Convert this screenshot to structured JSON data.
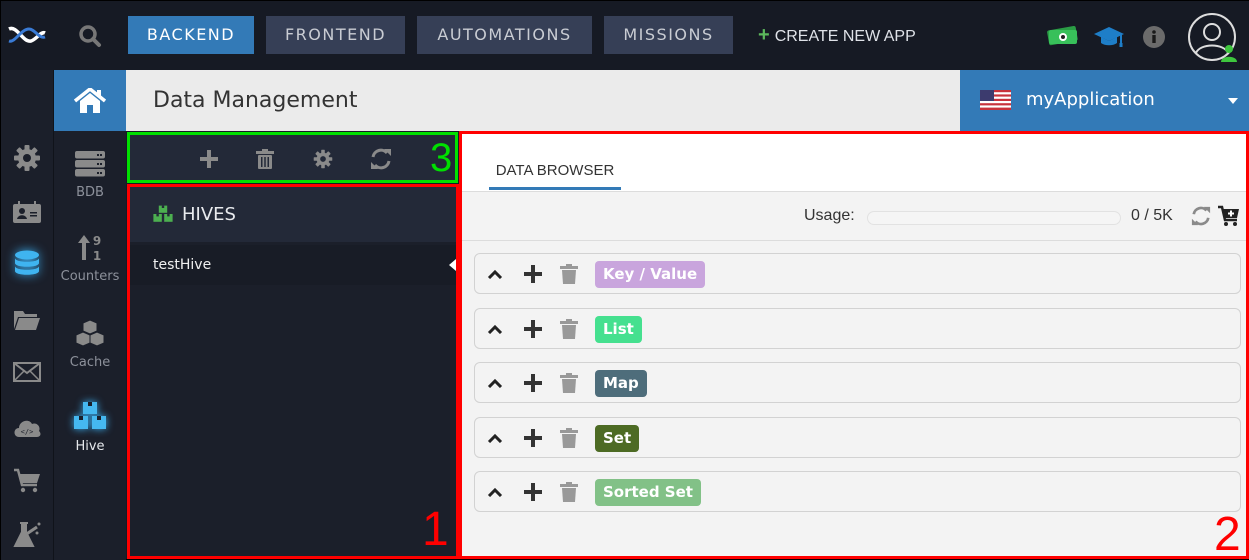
{
  "topbar": {
    "tabs": [
      {
        "label": "BACKEND",
        "active": true
      },
      {
        "label": "FRONTEND",
        "active": false
      },
      {
        "label": "AUTOMATIONS",
        "active": false
      },
      {
        "label": "MISSIONS",
        "active": false
      }
    ],
    "create_app_label": "CREATE NEW APP",
    "icons": [
      "logo-icon",
      "search-icon",
      "money-icon",
      "graduation-cap-icon",
      "info-icon",
      "user-avatar-icon"
    ]
  },
  "rail": {
    "items": [
      {
        "name": "settings",
        "icon": "gear-icon",
        "active": false
      },
      {
        "name": "users",
        "icon": "id-card-icon",
        "active": false
      },
      {
        "name": "data",
        "icon": "database-icon",
        "active": true
      },
      {
        "name": "files",
        "icon": "folder-icon",
        "active": false
      },
      {
        "name": "messaging",
        "icon": "envelope-icon",
        "active": false
      },
      {
        "name": "cloud-code",
        "icon": "cloud-code-icon",
        "active": false
      },
      {
        "name": "commerce",
        "icon": "cart-icon",
        "active": false
      },
      {
        "name": "lab",
        "icon": "flask-icon",
        "active": false
      }
    ]
  },
  "subnav": {
    "items": [
      {
        "label": "BDB",
        "icon": "server-icon",
        "active": false
      },
      {
        "label": "Counters",
        "icon": "counter-icon",
        "active": false
      },
      {
        "label": "Cache",
        "icon": "cubes-icon",
        "active": false
      },
      {
        "label": "Hive",
        "icon": "hive-icon",
        "active": true
      }
    ]
  },
  "header": {
    "title": "Data Management",
    "app_name": "myApplication",
    "colors": {
      "accent": "#337ab7"
    }
  },
  "toolbar": {
    "buttons": [
      "add",
      "delete",
      "settings",
      "refresh"
    ],
    "annotation": "3"
  },
  "hives_panel": {
    "title": "HIVES",
    "items": [
      {
        "name": "testHive",
        "selected": true
      }
    ],
    "annotation": "1"
  },
  "main": {
    "tab": "DATA BROWSER",
    "usage": {
      "label": "Usage:",
      "value": "0 / 5K",
      "fraction": 0
    },
    "types": [
      {
        "label": "Key / Value",
        "color": "#c9a5dd"
      },
      {
        "label": "List",
        "color": "#45e08f"
      },
      {
        "label": "Map",
        "color": "#4e6d7b"
      },
      {
        "label": "Set",
        "color": "#4d6b24"
      },
      {
        "label": "Sorted Set",
        "color": "#82c187"
      }
    ],
    "annotation": "2"
  }
}
